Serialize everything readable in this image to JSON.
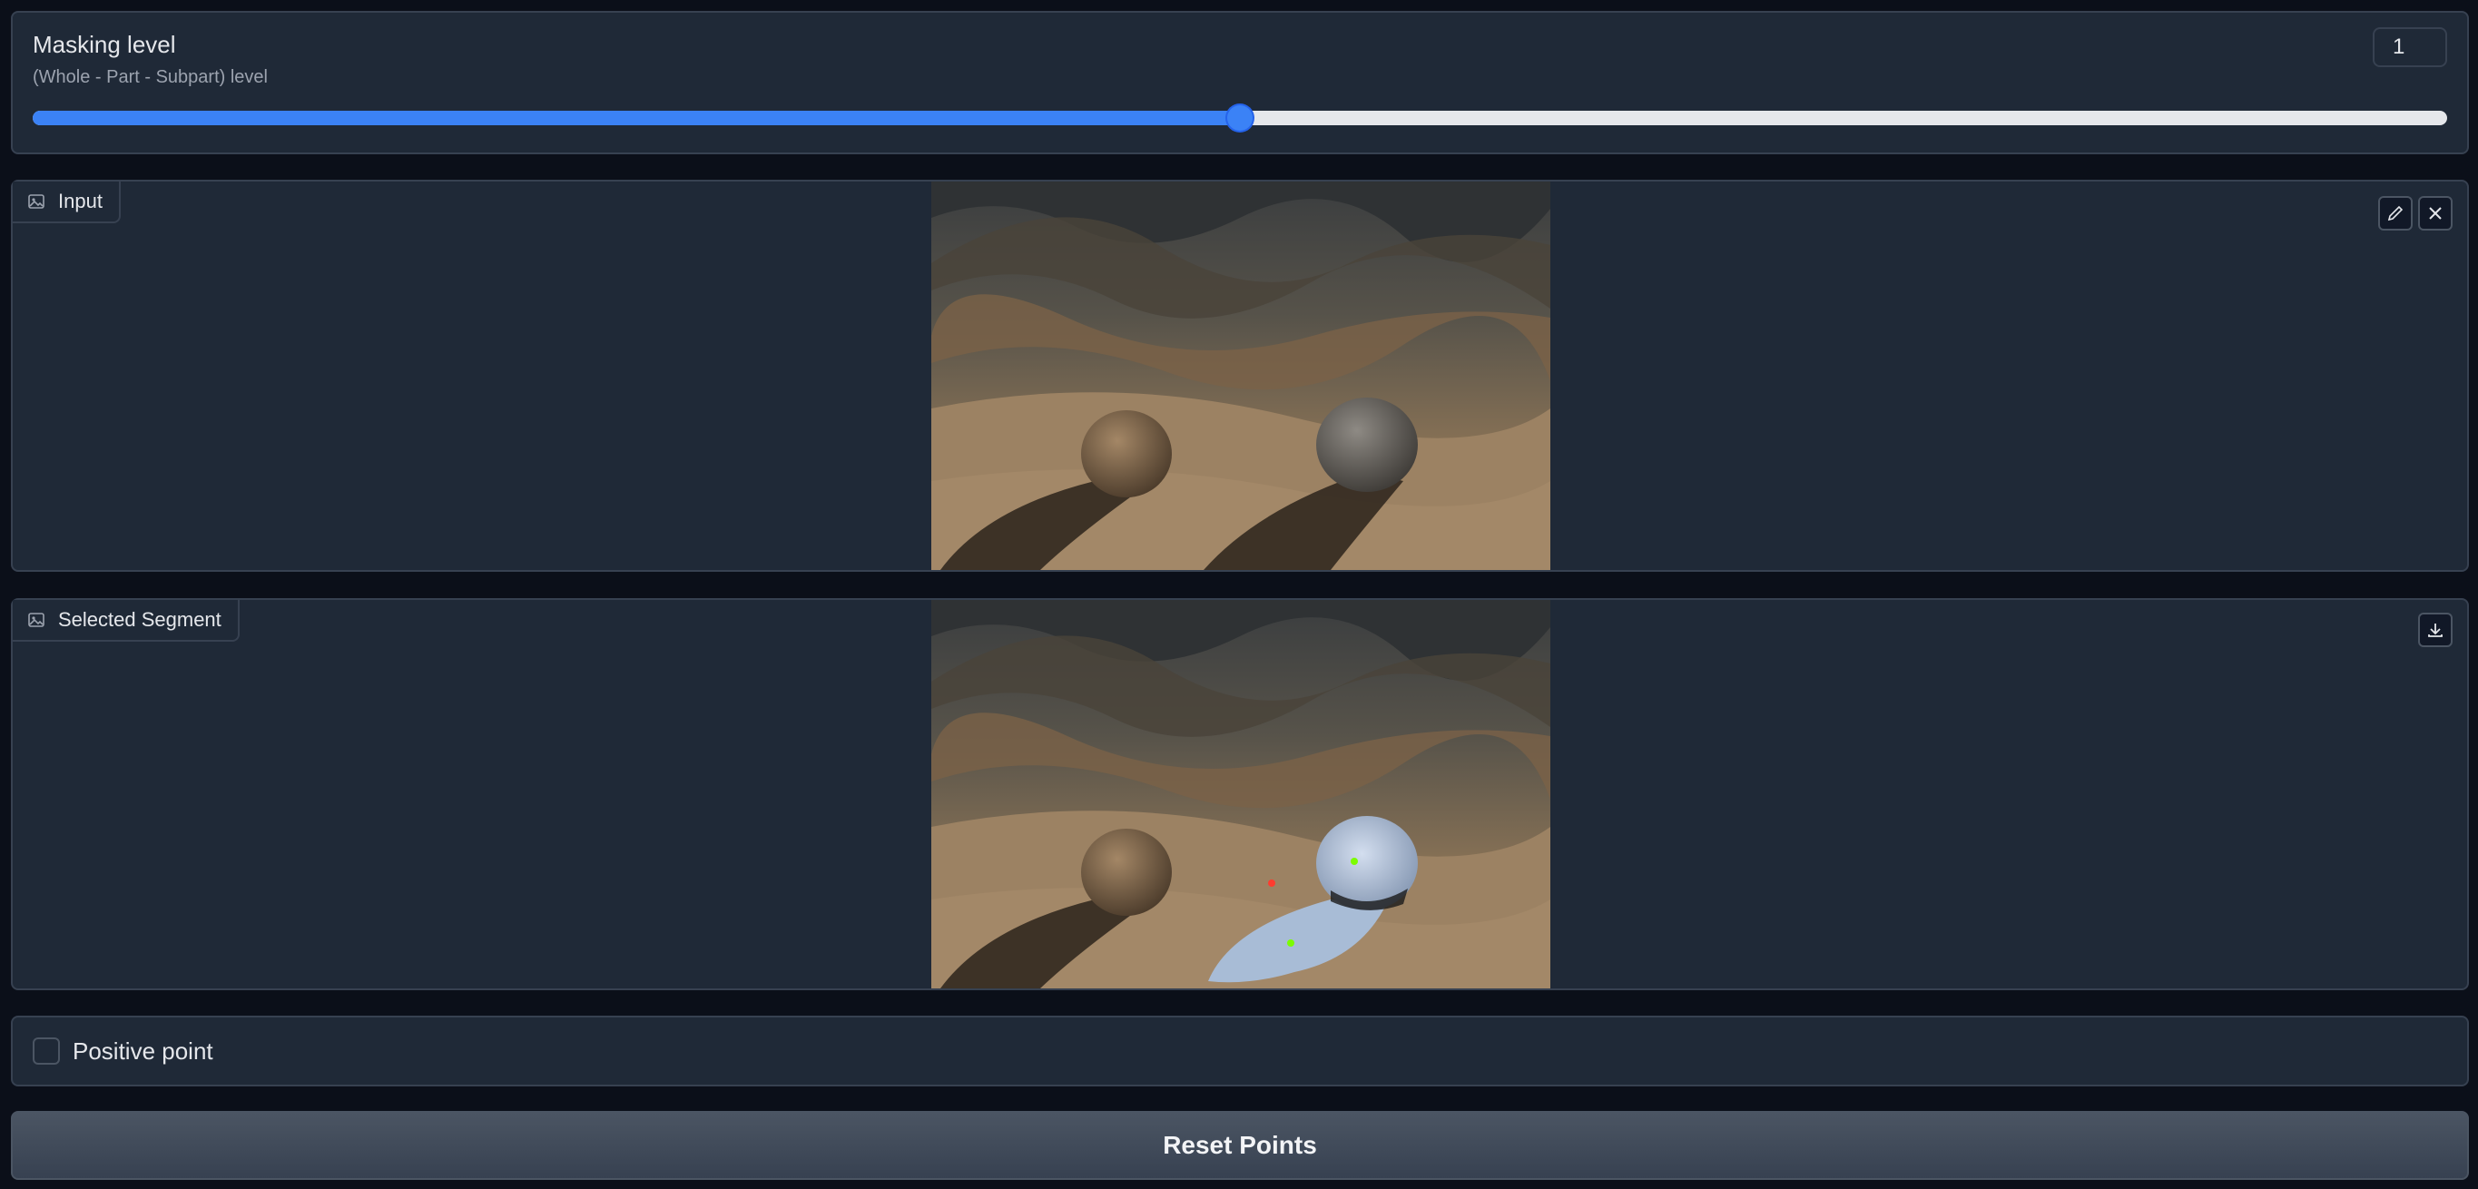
{
  "slider": {
    "label": "Masking level",
    "info": "(Whole - Part - Subpart) level",
    "value": "1",
    "fill_fraction": 0.5,
    "accent_color": "#3b82f6"
  },
  "input_image": {
    "label": "Input",
    "icon": "image-icon",
    "actions": [
      "edit-icon",
      "close-icon"
    ]
  },
  "segment_image": {
    "label": "Selected Segment",
    "icon": "image-icon",
    "actions": [
      "download-icon"
    ],
    "points": [
      {
        "type": "positive",
        "color": "#7CFC00"
      },
      {
        "type": "positive",
        "color": "#7CFC00"
      },
      {
        "type": "negative",
        "color": "#ff3b2f"
      }
    ]
  },
  "checkbox": {
    "label": "Positive point",
    "checked": false
  },
  "reset": {
    "label": "Reset Points"
  }
}
